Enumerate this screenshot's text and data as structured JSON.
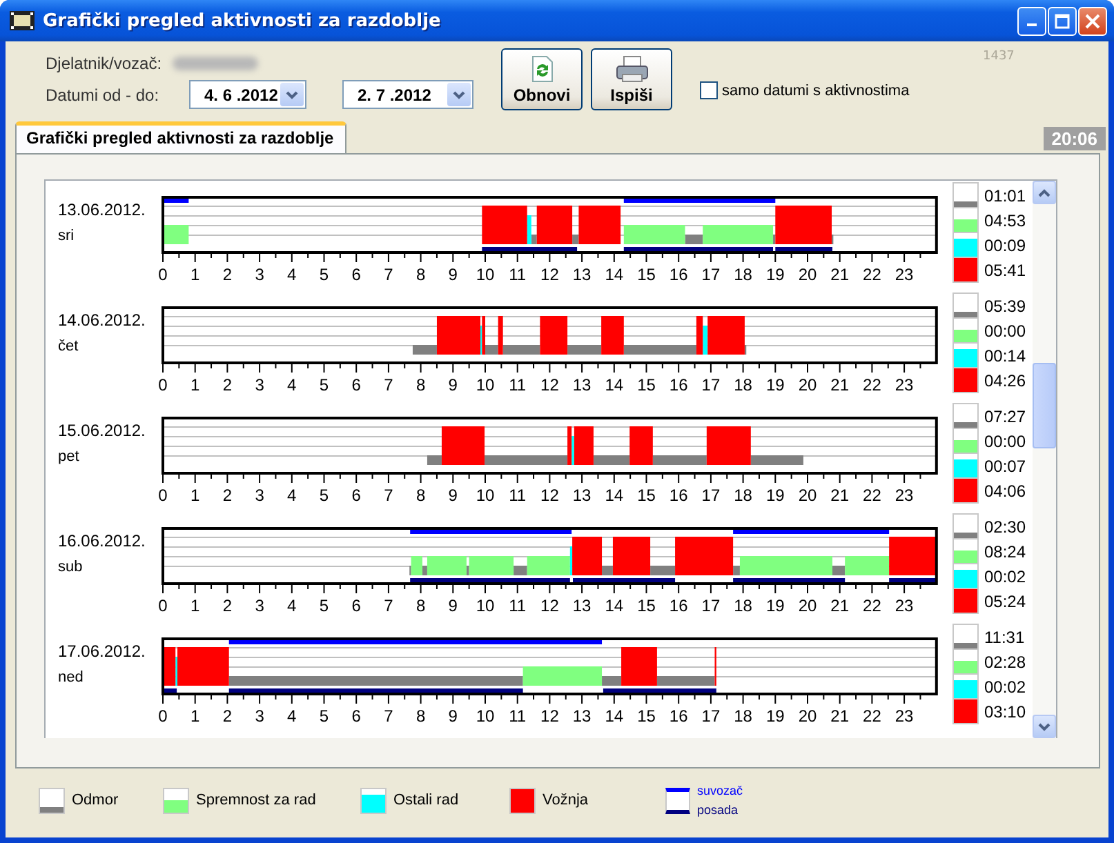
{
  "window": {
    "title": "Grafički pregled aktivnosti za razdoblje"
  },
  "form": {
    "employee_label": "Djelatnik/vozač:",
    "dates_label": "Datumi od - do:",
    "date_from": "4. 6 .2012",
    "date_to": "2. 7 .2012",
    "refresh_button": "Obnovi",
    "print_button": "Ispiši",
    "only_active": {
      "label": "samo datumi s aktivnostima",
      "checked": false
    },
    "code": "1437"
  },
  "tabs": [
    {
      "label": "Grafički pregled aktivnosti za razdoblje",
      "selected": true
    }
  ],
  "clock": "20:06",
  "days": [
    {
      "date": "13.06.2012.",
      "weekday": "sri",
      "hours": [
        "0",
        "1",
        "2",
        "3",
        "4",
        "5",
        "6",
        "7",
        "8",
        "9",
        "10",
        "11",
        "12",
        "13",
        "14",
        "15",
        "16",
        "17",
        "18",
        "19",
        "20",
        "21",
        "22",
        "23"
      ],
      "totals": [
        {
          "kind": "rest",
          "value": "01:01"
        },
        {
          "kind": "ready",
          "value": "04:53"
        },
        {
          "kind": "work",
          "value": "00:09"
        },
        {
          "kind": "drive",
          "value": "05:41"
        }
      ]
    },
    {
      "date": "14.06.2012.",
      "weekday": "čet",
      "hours": [
        "0",
        "1",
        "2",
        "3",
        "4",
        "5",
        "6",
        "7",
        "8",
        "9",
        "10",
        "11",
        "12",
        "13",
        "14",
        "15",
        "16",
        "17",
        "18",
        "19",
        "20",
        "21",
        "22",
        "23"
      ],
      "totals": [
        {
          "kind": "rest",
          "value": "05:39"
        },
        {
          "kind": "ready",
          "value": "00:00"
        },
        {
          "kind": "work",
          "value": "00:14"
        },
        {
          "kind": "drive",
          "value": "04:26"
        }
      ]
    },
    {
      "date": "15.06.2012.",
      "weekday": "pet",
      "hours": [
        "0",
        "1",
        "2",
        "3",
        "4",
        "5",
        "6",
        "7",
        "8",
        "9",
        "10",
        "11",
        "12",
        "13",
        "14",
        "15",
        "16",
        "17",
        "18",
        "19",
        "20",
        "21",
        "22",
        "23"
      ],
      "totals": [
        {
          "kind": "rest",
          "value": "07:27"
        },
        {
          "kind": "ready",
          "value": "00:00"
        },
        {
          "kind": "work",
          "value": "00:07"
        },
        {
          "kind": "drive",
          "value": "04:06"
        }
      ]
    },
    {
      "date": "16.06.2012.",
      "weekday": "sub",
      "hours": [
        "0",
        "1",
        "2",
        "3",
        "4",
        "5",
        "6",
        "7",
        "8",
        "9",
        "10",
        "11",
        "12",
        "13",
        "14",
        "15",
        "16",
        "17",
        "18",
        "19",
        "20",
        "21",
        "22",
        "23"
      ],
      "totals": [
        {
          "kind": "rest",
          "value": "02:30"
        },
        {
          "kind": "ready",
          "value": "08:24"
        },
        {
          "kind": "work",
          "value": "00:02"
        },
        {
          "kind": "drive",
          "value": "05:24"
        }
      ]
    },
    {
      "date": "17.06.2012.",
      "weekday": "ned",
      "hours": [
        "0",
        "1",
        "2",
        "3",
        "4",
        "5",
        "6",
        "7",
        "8",
        "9",
        "10",
        "11",
        "12",
        "13",
        "14",
        "15",
        "16",
        "17",
        "18",
        "19",
        "20",
        "21",
        "22",
        "23"
      ],
      "totals": [
        {
          "kind": "rest",
          "value": "11:31"
        },
        {
          "kind": "ready",
          "value": "02:28"
        },
        {
          "kind": "work",
          "value": "00:02"
        },
        {
          "kind": "drive",
          "value": "03:10"
        }
      ]
    }
  ],
  "legend": [
    {
      "kind": "rest",
      "label": "Odmor"
    },
    {
      "kind": "ready",
      "label": "Spremnost za rad"
    },
    {
      "kind": "work",
      "label": "Ostali rad"
    },
    {
      "kind": "drive",
      "label": "Vožnja"
    },
    {
      "kind": "crew",
      "labels": [
        "suvozač",
        "posada"
      ]
    }
  ]
}
